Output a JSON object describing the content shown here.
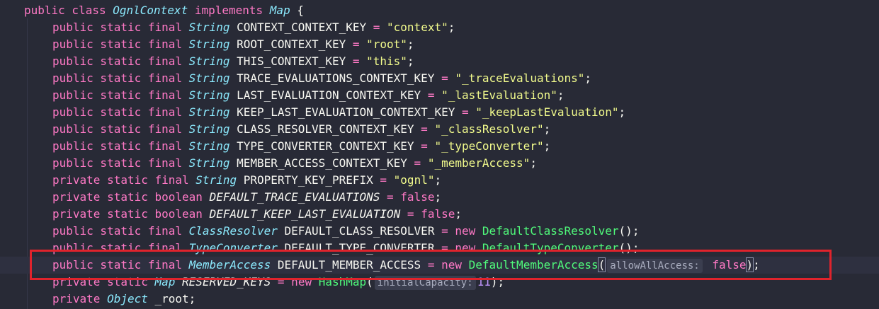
{
  "editor": {
    "language": "java",
    "lines": [
      {
        "tokens": [
          [
            "kw",
            "public class "
          ],
          [
            "type",
            "OgnlContext"
          ],
          [
            "kw",
            " implements "
          ],
          [
            "type",
            "Map"
          ],
          [
            "punc",
            " {"
          ]
        ]
      },
      {
        "tokens": [
          [
            "kw",
            "public static final "
          ],
          [
            "type",
            "String"
          ],
          [
            "field",
            " CONTEXT_CONTEXT_KEY "
          ],
          [
            "op",
            "="
          ],
          [
            "str",
            " \"context\""
          ],
          [
            "punc",
            ";"
          ]
        ]
      },
      {
        "tokens": [
          [
            "kw",
            "public static final "
          ],
          [
            "type",
            "String"
          ],
          [
            "field",
            " ROOT_CONTEXT_KEY "
          ],
          [
            "op",
            "="
          ],
          [
            "str",
            " \"root\""
          ],
          [
            "punc",
            ";"
          ]
        ]
      },
      {
        "tokens": [
          [
            "kw",
            "public static final "
          ],
          [
            "type",
            "String"
          ],
          [
            "field",
            " THIS_CONTEXT_KEY "
          ],
          [
            "op",
            "="
          ],
          [
            "str",
            " \"this\""
          ],
          [
            "punc",
            ";"
          ]
        ]
      },
      {
        "tokens": [
          [
            "kw",
            "public static final "
          ],
          [
            "type",
            "String"
          ],
          [
            "field",
            " TRACE_EVALUATIONS_CONTEXT_KEY "
          ],
          [
            "op",
            "="
          ],
          [
            "str",
            " \"_traceEvaluations\""
          ],
          [
            "punc",
            ";"
          ]
        ]
      },
      {
        "tokens": [
          [
            "kw",
            "public static final "
          ],
          [
            "type",
            "String"
          ],
          [
            "field",
            " LAST_EVALUATION_CONTEXT_KEY "
          ],
          [
            "op",
            "="
          ],
          [
            "str",
            " \"_lastEvaluation\""
          ],
          [
            "punc",
            ";"
          ]
        ]
      },
      {
        "tokens": [
          [
            "kw",
            "public static final "
          ],
          [
            "type",
            "String"
          ],
          [
            "field",
            " KEEP_LAST_EVALUATION_CONTEXT_KEY "
          ],
          [
            "op",
            "="
          ],
          [
            "str",
            " \"_keepLastEvaluation\""
          ],
          [
            "punc",
            ";"
          ]
        ]
      },
      {
        "tokens": [
          [
            "kw",
            "public static final "
          ],
          [
            "type",
            "String"
          ],
          [
            "field",
            " CLASS_RESOLVER_CONTEXT_KEY "
          ],
          [
            "op",
            "="
          ],
          [
            "str",
            " \"_classResolver\""
          ],
          [
            "punc",
            ";"
          ]
        ]
      },
      {
        "tokens": [
          [
            "kw",
            "public static final "
          ],
          [
            "type",
            "String"
          ],
          [
            "field",
            " TYPE_CONVERTER_CONTEXT_KEY "
          ],
          [
            "op",
            "="
          ],
          [
            "str",
            " \"_typeConverter\""
          ],
          [
            "punc",
            ";"
          ]
        ]
      },
      {
        "tokens": [
          [
            "kw",
            "public static final "
          ],
          [
            "type",
            "String"
          ],
          [
            "field",
            " MEMBER_ACCESS_CONTEXT_KEY "
          ],
          [
            "op",
            "="
          ],
          [
            "str",
            " \"_memberAccess\""
          ],
          [
            "punc",
            ";"
          ]
        ]
      },
      {
        "tokens": [
          [
            "kw",
            "private static final "
          ],
          [
            "type",
            "String"
          ],
          [
            "field",
            " PROPERTY_KEY_PREFIX "
          ],
          [
            "op",
            "="
          ],
          [
            "str",
            " \"ognl\""
          ],
          [
            "punc",
            ";"
          ]
        ]
      },
      {
        "tokens": [
          [
            "kw",
            "private static boolean "
          ],
          [
            "sfield",
            "DEFAULT_TRACE_EVALUATIONS "
          ],
          [
            "op",
            "="
          ],
          [
            "bool",
            " false"
          ],
          [
            "punc",
            ";"
          ]
        ]
      },
      {
        "tokens": [
          [
            "kw",
            "private static boolean "
          ],
          [
            "sfield",
            "DEFAULT_KEEP_LAST_EVALUATION "
          ],
          [
            "op",
            "="
          ],
          [
            "bool",
            " false"
          ],
          [
            "punc",
            ";"
          ]
        ]
      },
      {
        "tokens": [
          [
            "kw",
            "public static final "
          ],
          [
            "type",
            "ClassResolver"
          ],
          [
            "field",
            " DEFAULT_CLASS_RESOLVER "
          ],
          [
            "op",
            "="
          ],
          [
            "kw",
            " new "
          ],
          [
            "cls",
            "DefaultClassResolver"
          ],
          [
            "punc",
            "();"
          ]
        ]
      },
      {
        "tokens": [
          [
            "kw",
            "public static final "
          ],
          [
            "type",
            "TypeConverter"
          ],
          [
            "field",
            " DEFAULT_TYPE_CONVERTER "
          ],
          [
            "op",
            "="
          ],
          [
            "kw",
            " new "
          ],
          [
            "cls",
            "DefaultTypeConverter"
          ],
          [
            "punc",
            "();"
          ]
        ]
      },
      {
        "current": true,
        "tokens": [
          [
            "kw",
            "public static final "
          ],
          [
            "type",
            "MemberAccess"
          ],
          [
            "field",
            " DEFAULT_MEMBER_ACCESS "
          ],
          [
            "op",
            "="
          ],
          [
            "kw",
            " new "
          ],
          [
            "cls",
            "DefaultMemberAccess"
          ],
          [
            "paren-hl",
            "("
          ],
          [
            "caret",
            ""
          ],
          [
            "hint",
            "allowAllAccess:"
          ],
          [
            "bool",
            " false"
          ],
          [
            "paren-hl",
            ")"
          ],
          [
            "punc",
            ";"
          ]
        ]
      },
      {
        "tokens": [
          [
            "kw",
            "private static "
          ],
          [
            "type",
            "Map"
          ],
          [
            "sfield",
            " RESERVED_KEYS "
          ],
          [
            "op",
            "="
          ],
          [
            "kw",
            " new "
          ],
          [
            "cls",
            "HashMap"
          ],
          [
            "punc",
            "("
          ],
          [
            "hint-dim",
            "initialCapacity:"
          ],
          [
            "num",
            "11"
          ],
          [
            "punc",
            ");"
          ]
        ]
      },
      {
        "tokens": [
          [
            "kw",
            "private "
          ],
          [
            "type",
            "Object"
          ],
          [
            "field",
            " _root"
          ],
          [
            "punc",
            ";"
          ]
        ]
      }
    ]
  },
  "colors": {
    "background": "#282a36",
    "highlight_box": "#e0232c"
  }
}
